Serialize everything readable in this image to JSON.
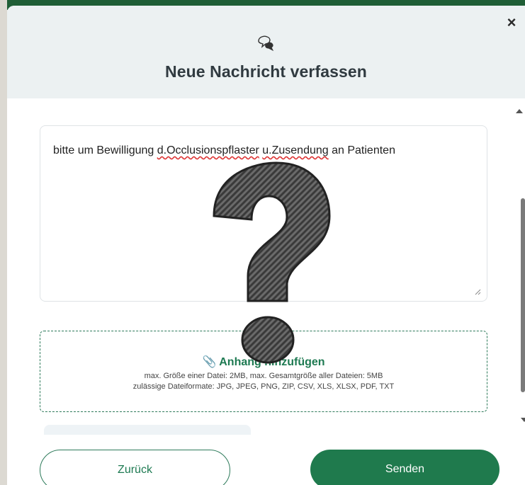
{
  "dialog": {
    "title": "Neue Nachricht verfassen",
    "close_label": "×",
    "header_icon": "chat-bubbles-icon"
  },
  "message": {
    "text_before": "bitte um Bewilligung ",
    "word1": "d.Occlusionspflaster",
    "space": " ",
    "word2": "u.Zusendung",
    "text_after": " an Patienten"
  },
  "attachment": {
    "label": "Anhang hinzufügen",
    "icon": "paperclip-icon",
    "info_line1": "max. Größe einer Datei: 2MB, max. Gesamtgröße aller Dateien: 5MB",
    "info_line2": "zulässige Dateiformate: JPG, JPEG, PNG, ZIP, CSV, XLS, XLSX, PDF, TXT"
  },
  "buttons": {
    "back_label": "Zurück",
    "send_label": "Senden"
  },
  "colors": {
    "primary": "#1f7a4d",
    "header_bg": "#ecf1f2",
    "title": "#303a40"
  }
}
